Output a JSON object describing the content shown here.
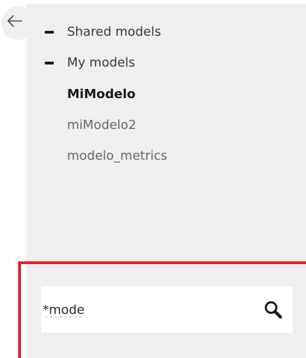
{
  "tree": {
    "groups": [
      {
        "label": "Shared models",
        "state": "expanded"
      },
      {
        "label": "My models",
        "state": "expanded"
      }
    ],
    "my_models": [
      {
        "label": "MiModelo",
        "selected": true
      },
      {
        "label": "miModelo2",
        "selected": false
      },
      {
        "label": "modelo_metrics",
        "selected": false
      }
    ]
  },
  "search": {
    "value": "*mode",
    "highlight_color": "#e8202a"
  },
  "icons": {
    "back": "arrow-left-icon",
    "collapse": "minus-icon",
    "search": "magnifier-icon"
  }
}
